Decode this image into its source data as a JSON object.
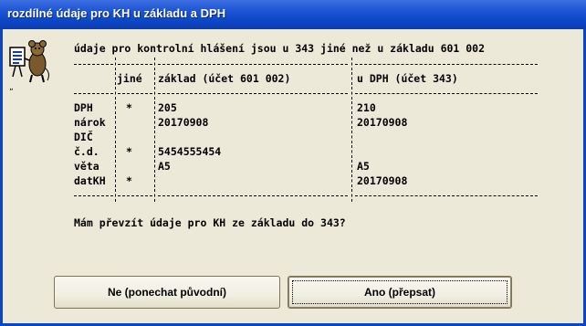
{
  "window": {
    "title": "rozdílné údaje pro KH u základu a DPH"
  },
  "message": {
    "headline": "údaje pro kontrolní hlášení jsou u 343 jiné než u základu 601 002",
    "question": "Mám převzít údaje pro KH ze základu do 343?"
  },
  "table": {
    "headers": {
      "label": "",
      "jine": "jiné",
      "zaklad": "základ (účet 601 002)",
      "dph": "u DPH (účet 343)"
    },
    "rows": [
      {
        "label": "DPH",
        "jine": "*",
        "zaklad": "205",
        "dph": "210"
      },
      {
        "label": "nárok",
        "jine": "",
        "zaklad": "20170908",
        "dph": "20170908"
      },
      {
        "label": "DIČ",
        "jine": "",
        "zaklad": "",
        "dph": ""
      },
      {
        "label": "č.d.",
        "jine": "*",
        "zaklad": "5454555454",
        "dph": ""
      },
      {
        "label": "věta",
        "jine": "",
        "zaklad": "A5",
        "dph": "A5"
      },
      {
        "label": "datKH",
        "jine": "*",
        "zaklad": "",
        "dph": "20170908"
      }
    ]
  },
  "buttons": {
    "no_label": "Ne (ponechat původní)",
    "yes_label": "Ano (přepsat)"
  },
  "icons": {
    "mascot": "mouse-with-document-icon"
  },
  "colors": {
    "titlebar": "#0b45c4",
    "dialog_bg": "#ece9d8"
  }
}
